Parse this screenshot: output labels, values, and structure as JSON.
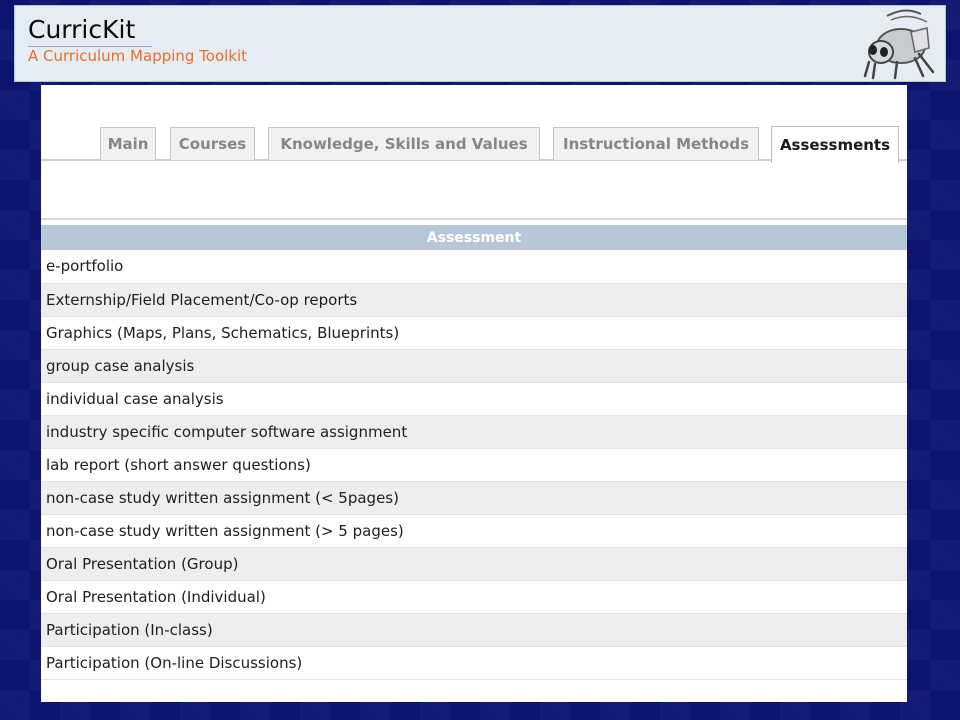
{
  "app": {
    "title": "CurricKit",
    "subtitle": "A Curriculum Mapping Toolkit"
  },
  "tabs": [
    {
      "label": "Main"
    },
    {
      "label": "Courses"
    },
    {
      "label": "Knowledge, Skills and Values"
    },
    {
      "label": "Instructional Methods"
    },
    {
      "label": "Assessments",
      "active": true
    }
  ],
  "table": {
    "header": "Assessment",
    "rows": [
      "e-portfolio",
      "Externship/Field Placement/Co-op reports",
      "Graphics (Maps, Plans, Schematics, Blueprints)",
      "group case analysis",
      "individual case analysis",
      "industry specific computer software assignment",
      "lab report (short answer questions)",
      "non-case study written assignment (< 5pages)",
      "non-case study written assignment (> 5 pages)",
      "Oral Presentation (Group)",
      "Oral Presentation (Individual)",
      "Participation (In-class)",
      "Participation (On-line Discussions)"
    ]
  },
  "colors": {
    "background": "#0c1470",
    "subtitle": "#e5702a",
    "table_header": "#b8c7d8"
  },
  "icons": {
    "logo": "cricket-mascot-icon"
  }
}
